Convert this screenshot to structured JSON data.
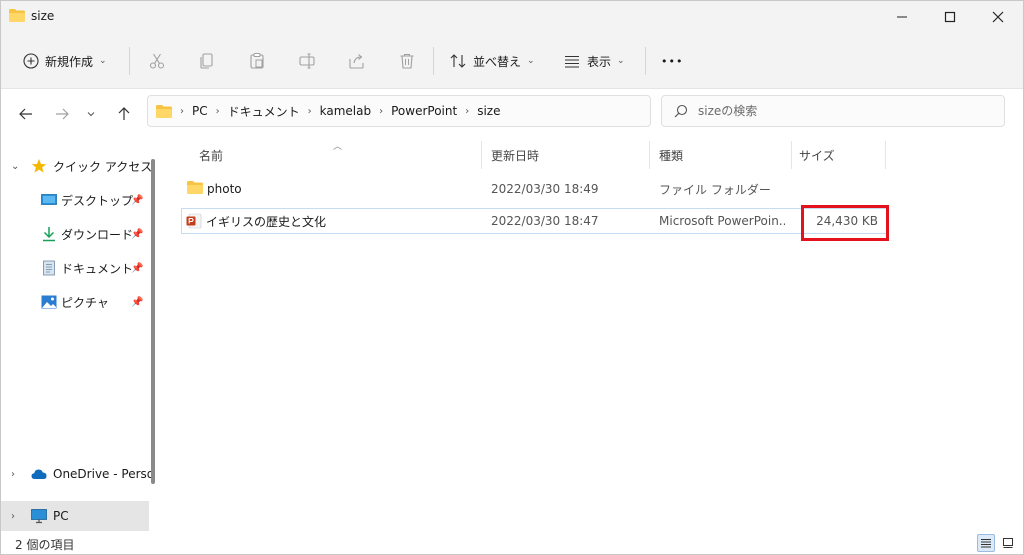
{
  "window": {
    "title": "size",
    "folder_color": "#f6c343",
    "accent": "#0067c0",
    "highlight_color": "#e4121c"
  },
  "commandbar": {
    "new_label": "新規作成",
    "sort_label": "並べ替え",
    "view_label": "表示",
    "more_label": "•••",
    "icons": [
      "plus-circle-icon",
      "cut-icon",
      "copy-icon",
      "paste-icon",
      "rename-icon",
      "share-icon",
      "delete-icon",
      "sort-icon",
      "view-icon"
    ]
  },
  "address": {
    "crumbs": [
      "PC",
      "ドキュメント",
      "kamelab",
      "PowerPoint",
      "size"
    ],
    "search_placeholder": "sizeの検索"
  },
  "nav": {
    "quick_access": "クイック アクセス",
    "items": [
      {
        "label": "デスクトップ",
        "icon": "desktop-icon"
      },
      {
        "label": "ダウンロード",
        "icon": "download-icon"
      },
      {
        "label": "ドキュメント",
        "icon": "document-icon"
      },
      {
        "label": "ピクチャ",
        "icon": "pictures-icon"
      }
    ],
    "onedrive": "OneDrive - Perso",
    "pc": "PC"
  },
  "filelist": {
    "columns": {
      "name": "名前",
      "date": "更新日時",
      "type": "種類",
      "size": "サイズ"
    },
    "rows": [
      {
        "name": "photo",
        "date": "2022/03/30 18:49",
        "type": "ファイル フォルダー",
        "size": "",
        "icon": "folder-icon"
      },
      {
        "name": "イギリスの歴史と文化",
        "date": "2022/03/30 18:47",
        "type": "Microsoft PowerPoin...",
        "size": "24,430 KB",
        "icon": "powerpoint-icon"
      }
    ]
  },
  "status": {
    "item_count": "2 個の項目"
  }
}
